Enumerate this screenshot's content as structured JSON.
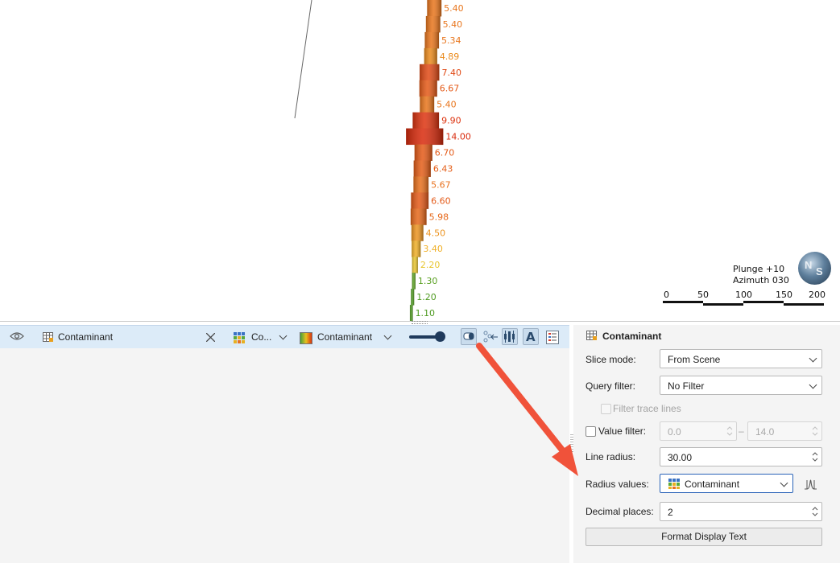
{
  "viewport": {
    "labels": [
      {
        "text": "5.40",
        "color": "#e8751c"
      },
      {
        "text": "5.40",
        "color": "#e8751c"
      },
      {
        "text": "5.34",
        "color": "#e8751c"
      },
      {
        "text": "4.89",
        "color": "#ea8a1c"
      },
      {
        "text": "7.40",
        "color": "#e04a16"
      },
      {
        "text": "6.67",
        "color": "#e45a18"
      },
      {
        "text": "5.40",
        "color": "#e8751c"
      },
      {
        "text": "9.90",
        "color": "#dd3410"
      },
      {
        "text": "14.00",
        "color": "#d82a0c"
      },
      {
        "text": "6.70",
        "color": "#e45a18"
      },
      {
        "text": "6.43",
        "color": "#e45e18"
      },
      {
        "text": "5.67",
        "color": "#e8701c"
      },
      {
        "text": "6.60",
        "color": "#e45a18"
      },
      {
        "text": "5.98",
        "color": "#e6681a"
      },
      {
        "text": "4.50",
        "color": "#ec9420"
      },
      {
        "text": "3.40",
        "color": "#f0b028"
      },
      {
        "text": "2.20",
        "color": "#e8c630"
      },
      {
        "text": "1.30",
        "color": "#5aa022"
      },
      {
        "text": "1.20",
        "color": "#4e9a20"
      },
      {
        "text": "1.10",
        "color": "#4e9a20"
      }
    ],
    "plunge": "Plunge +10",
    "azimuth": "Azimuth 030",
    "scale_ticks": [
      "0",
      "50",
      "100",
      "150",
      "200"
    ],
    "compass_letters": [
      "N",
      "S"
    ]
  },
  "toolbar": {
    "table_name": "Contaminant",
    "radius_column": "Co...",
    "colour_column": "Contaminant"
  },
  "props": {
    "title": "Contaminant",
    "slice_mode_label": "Slice mode:",
    "slice_mode_value": "From Scene",
    "query_filter_label": "Query filter:",
    "query_filter_value": "No Filter",
    "filter_trace_label": "Filter trace lines",
    "value_filter_label": "Value filter:",
    "value_filter_min": "0.0",
    "value_filter_sep": "–",
    "value_filter_max": "14.0",
    "line_radius_label": "Line radius:",
    "line_radius_value": "30.00",
    "radius_values_label": "Radius values:",
    "radius_values_value": "Contaminant",
    "decimal_places_label": "Decimal places:",
    "decimal_places_value": "2",
    "format_button": "Format Display Text"
  },
  "colors": {
    "accent_arrow": "#f0523a",
    "toolbar_bg": "#dcebf8",
    "panel_bg": "#f4f4f4"
  }
}
